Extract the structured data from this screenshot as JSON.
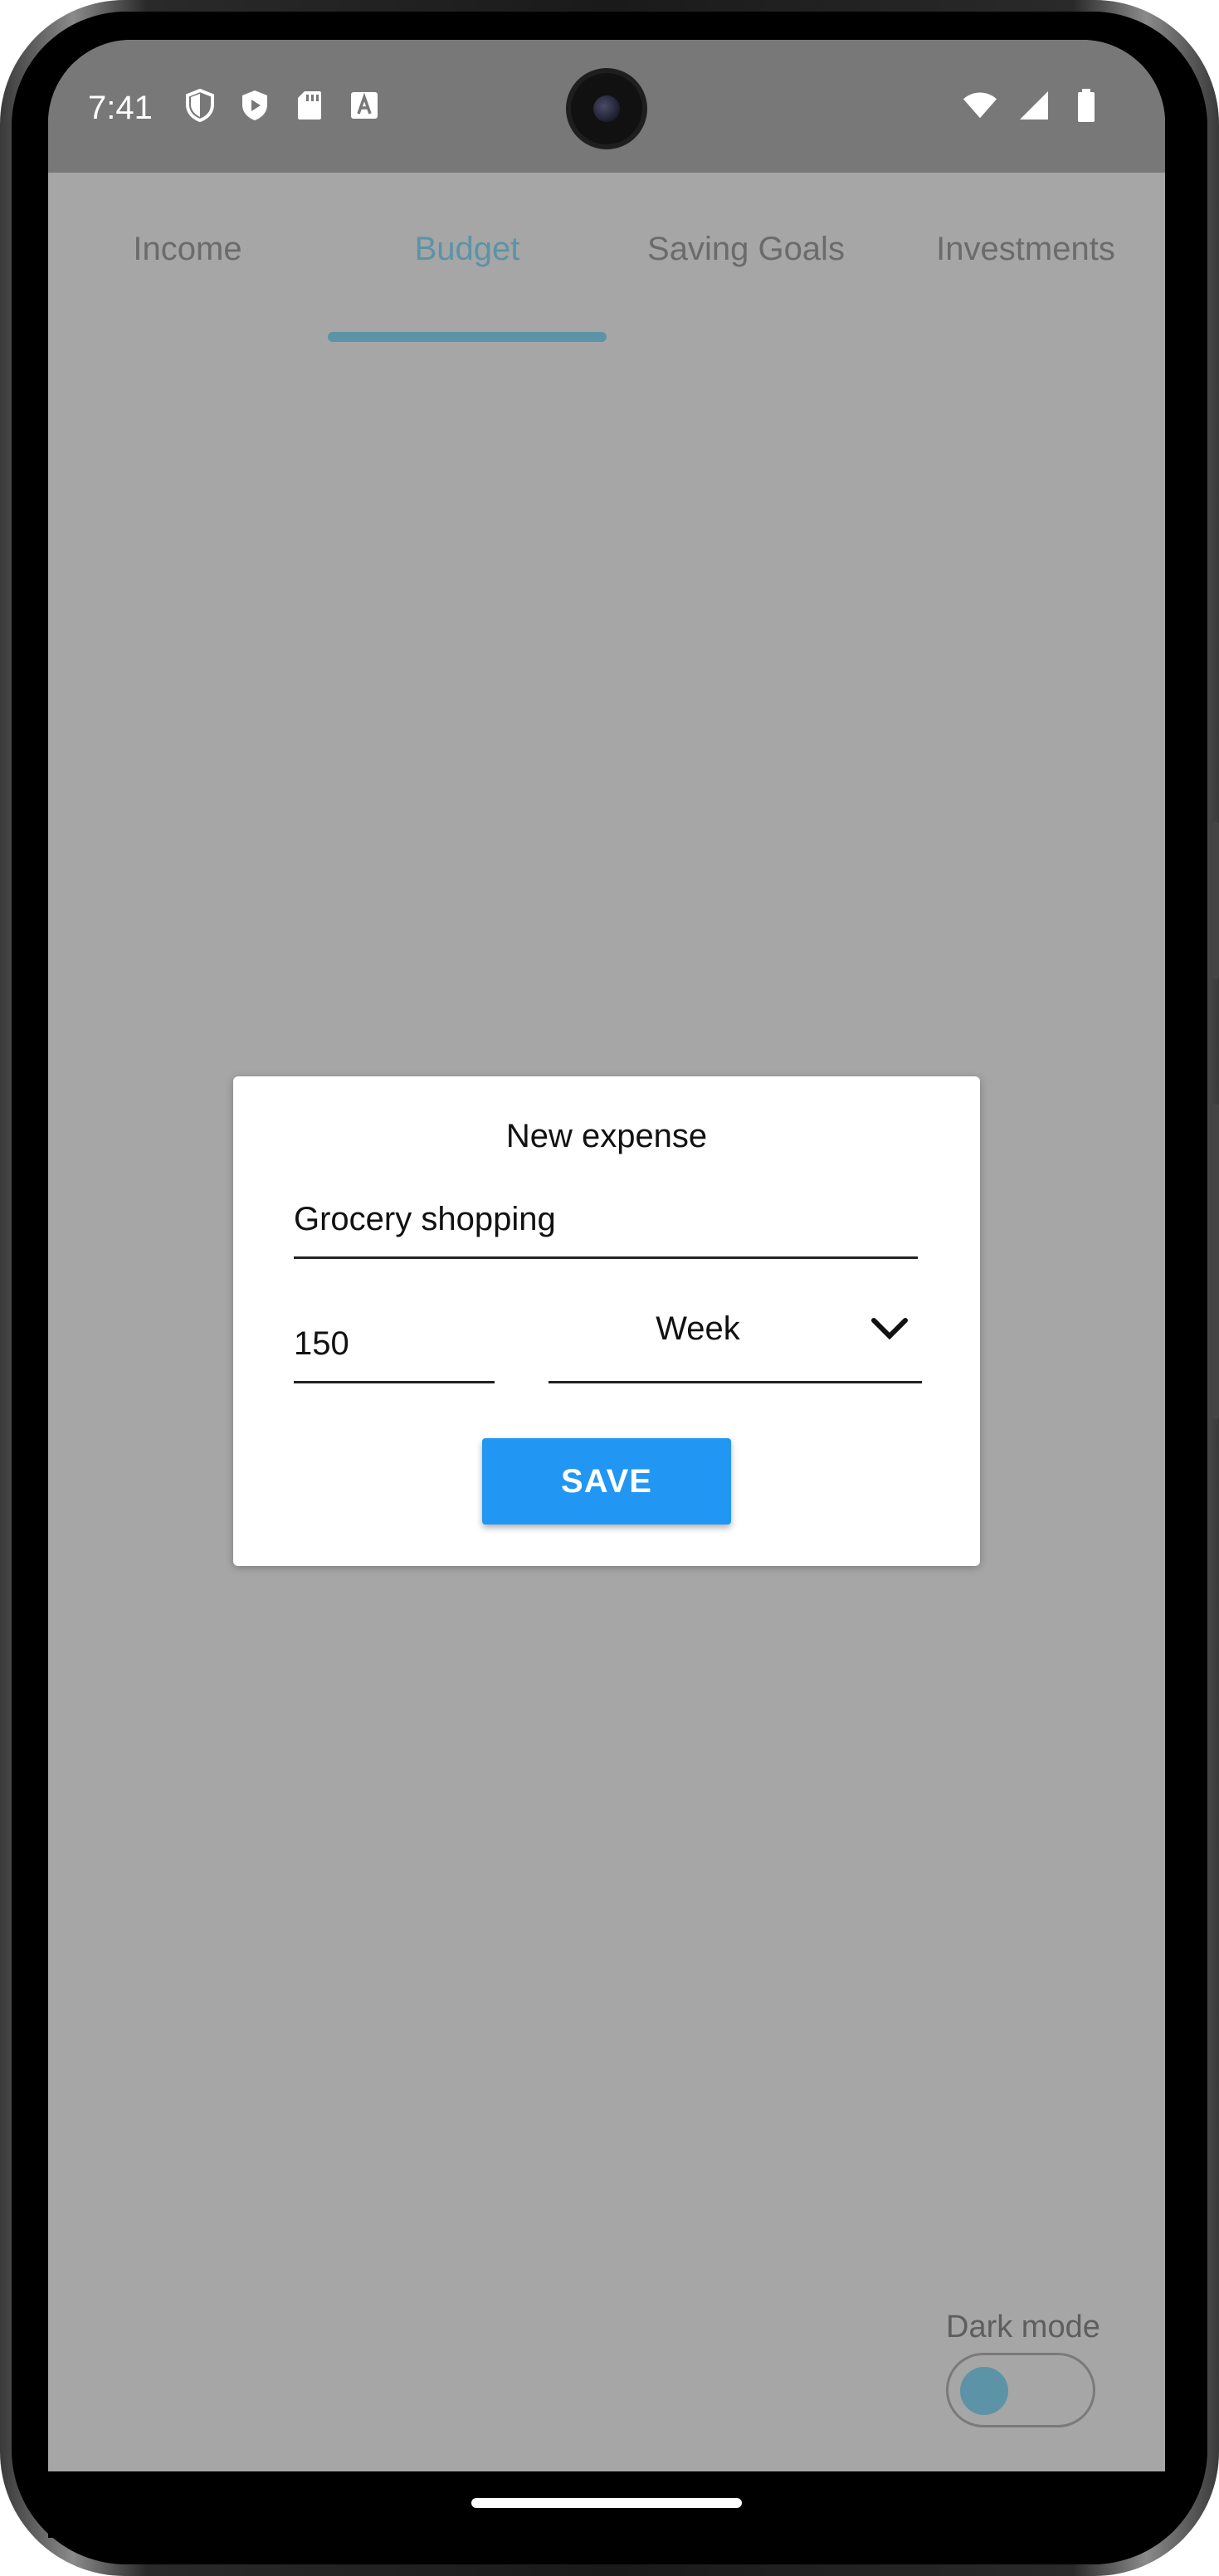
{
  "status_bar": {
    "time": "7:41",
    "left_icons": [
      "shield-icon",
      "play-protect-icon",
      "sd-card-icon",
      "font-a-icon"
    ],
    "right_icons": [
      "wifi-icon",
      "signal-icon",
      "battery-icon"
    ]
  },
  "tabs": [
    {
      "label": "Income",
      "active": false
    },
    {
      "label": "Budget",
      "active": true
    },
    {
      "label": "Saving Goals",
      "active": false
    },
    {
      "label": "Investments",
      "active": false
    }
  ],
  "dialog": {
    "title": "New expense",
    "name_value": "Grocery shopping",
    "amount_value": "150",
    "period_value": "Week",
    "save_label": "SAVE"
  },
  "dark_mode": {
    "label": "Dark mode",
    "enabled": false
  },
  "colors": {
    "accent": "#5c93a7",
    "save_button": "#2196f3",
    "scrim": "#a6a6a6",
    "status_bar": "#787878"
  }
}
